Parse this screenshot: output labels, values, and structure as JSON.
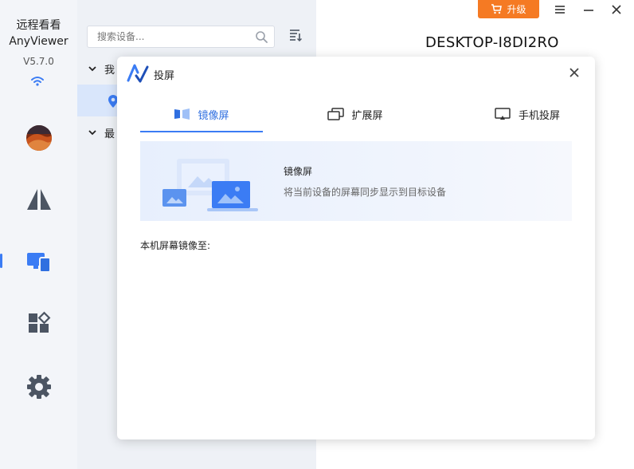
{
  "app": {
    "name_line1": "远程看看",
    "name_line2": "AnyViewer",
    "version": "V5.7.0"
  },
  "nav": [
    {
      "icon": "avatar"
    },
    {
      "icon": "connect-icon"
    },
    {
      "icon": "devices-icon",
      "active": true
    },
    {
      "icon": "apps-icon"
    },
    {
      "icon": "gear-icon"
    }
  ],
  "device_panel": {
    "search_placeholder": "搜索设备...",
    "groups": [
      {
        "label": "我"
      },
      {
        "label": "最"
      }
    ]
  },
  "header": {
    "upgrade_label": "升级",
    "device_name": "DESKTOP-I8DI2RO"
  },
  "modal": {
    "title": "投屏",
    "tabs": [
      {
        "label": "镜像屏",
        "active": true
      },
      {
        "label": "扩展屏",
        "active": false
      },
      {
        "label": "手机投屏",
        "active": false
      }
    ],
    "banner_title": "镜像屏",
    "banner_desc": "将当前设备的屏幕同步显示到目标设备",
    "mirror_to_label": "本机屏幕镜像至:"
  },
  "colors": {
    "accent": "#3b7cf4",
    "upgrade": "#f57a23",
    "sidebar_bg": "#f3f5f9",
    "panel_bg": "#eef1f6"
  }
}
